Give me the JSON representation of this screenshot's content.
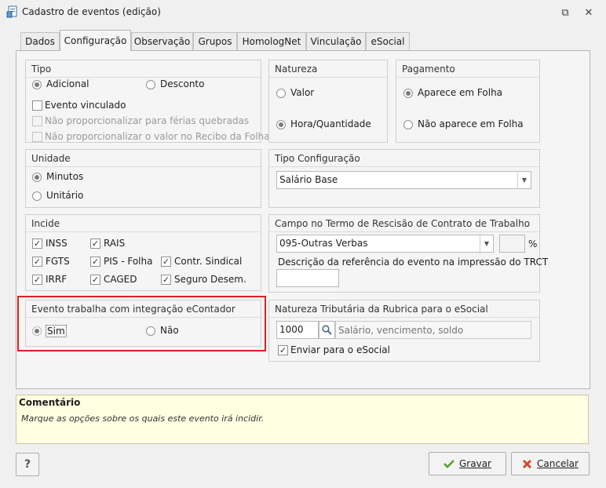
{
  "window": {
    "title": "Cadastro de eventos (edição)",
    "restore_glyph": "⧉",
    "close_glyph": "✕"
  },
  "tabs": [
    "Dados",
    "Configuração",
    "Observação",
    "Grupos",
    "HomologNet",
    "Vinculação",
    "eSocial"
  ],
  "tipo": {
    "title": "Tipo",
    "adicional": "Adicional",
    "desconto": "Desconto",
    "selected": "Adicional",
    "evento_vinculado": "Evento vinculado",
    "nao_prop_ferias": "Não proporcionalizar para férias quebradas",
    "nao_prop_recibo": "Não proporcionalizar o valor no Recibo da Folha"
  },
  "natureza": {
    "title": "Natureza",
    "valor": "Valor",
    "hora_quantidade": "Hora/Quantidade",
    "selected": "Hora/Quantidade"
  },
  "pagamento": {
    "title": "Pagamento",
    "aparece": "Aparece em Folha",
    "nao_aparece": "Não aparece em Folha",
    "selected": "Aparece em Folha"
  },
  "unidade": {
    "title": "Unidade",
    "minutos": "Minutos",
    "unitario": "Unitário",
    "selected": "Minutos"
  },
  "tipo_configuracao": {
    "title": "Tipo Configuração",
    "value": "Salário Base"
  },
  "incide": {
    "title": "Incide",
    "items": {
      "inss": "INSS",
      "rais": "RAIS",
      "fgts": "FGTS",
      "pis": "PIS - Folha",
      "contr": "Contr. Sindical",
      "irrf": "IRRF",
      "caged": "CAGED",
      "seguro": "Seguro Desem."
    },
    "check_mark": "✓"
  },
  "campo_termo": {
    "title": "Campo no Termo de Rescisão de Contrato de Trabalho",
    "value": "095-Outras Verbas",
    "percent_value": "",
    "percent_symbol": "%",
    "descricao_label": "Descrição da referência do evento na impressão do TRCT",
    "descricao_value": ""
  },
  "econtador": {
    "title": "Evento trabalha com integração eContador",
    "sim": "Sim",
    "nao": "Não",
    "selected": "Sim"
  },
  "natureza_tributaria": {
    "title": "Natureza Tributária da Rubrica para o eSocial",
    "code": "1000",
    "placeholder": "Salário, vencimento, soldo",
    "enviar": "Enviar para o eSocial"
  },
  "comment": {
    "title": "Comentário",
    "text": "Marque as opções sobre os quais este evento irá incidir."
  },
  "buttons": {
    "help": "?",
    "gravar": "Gravar",
    "cancelar": "Cancelar"
  },
  "colors": {
    "highlight": "#e02020",
    "comment_bg": "#ffffe1",
    "gravar_icon": "#5aa02c",
    "cancelar_icon": "#d9452b"
  }
}
